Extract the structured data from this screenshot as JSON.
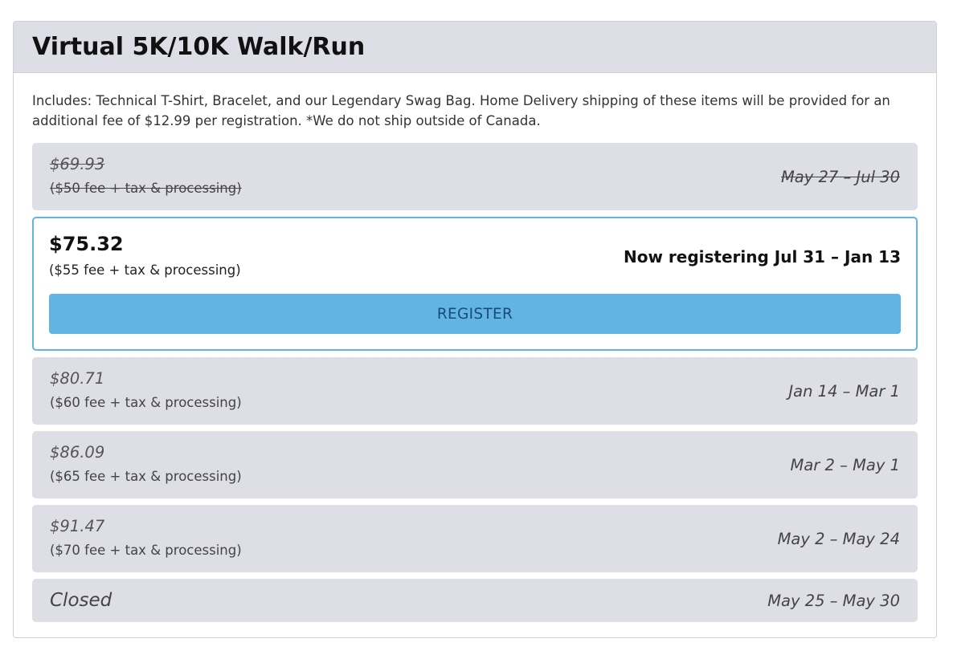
{
  "event": {
    "title": "Virtual 5K/10K Walk/Run",
    "includes": "Includes: Technical T-Shirt, Bracelet, and our Legendary Swag Bag. Home Delivery shipping of these items will be provided for an\nadditional fee of $12.99 per registration. *We do not ship outside of Canada."
  },
  "tiers": [
    {
      "price": "$69.93",
      "fee": "($50 fee + tax & processing)",
      "dates": "May 27 – Jul 30",
      "status": "past"
    },
    {
      "price": "$75.32",
      "fee": "($55 fee + tax & processing)",
      "dates": "Now registering Jul 31 – Jan 13",
      "status": "current",
      "button_label": "REGISTER"
    },
    {
      "price": "$80.71",
      "fee": "($60 fee + tax & processing)",
      "dates": "Jan 14 – Mar 1",
      "status": "future"
    },
    {
      "price": "$86.09",
      "fee": "($65 fee + tax & processing)",
      "dates": "Mar 2 – May 1",
      "status": "future"
    },
    {
      "price": "$91.47",
      "fee": "($70 fee + tax & processing)",
      "dates": "May 2 – May 24",
      "status": "future"
    },
    {
      "price": "Closed",
      "dates": "May 25 – May 30",
      "status": "closed"
    }
  ],
  "colors": {
    "accent": "#61b4e4",
    "button_text": "#1a4c78",
    "tier_background": "#dedee6"
  }
}
